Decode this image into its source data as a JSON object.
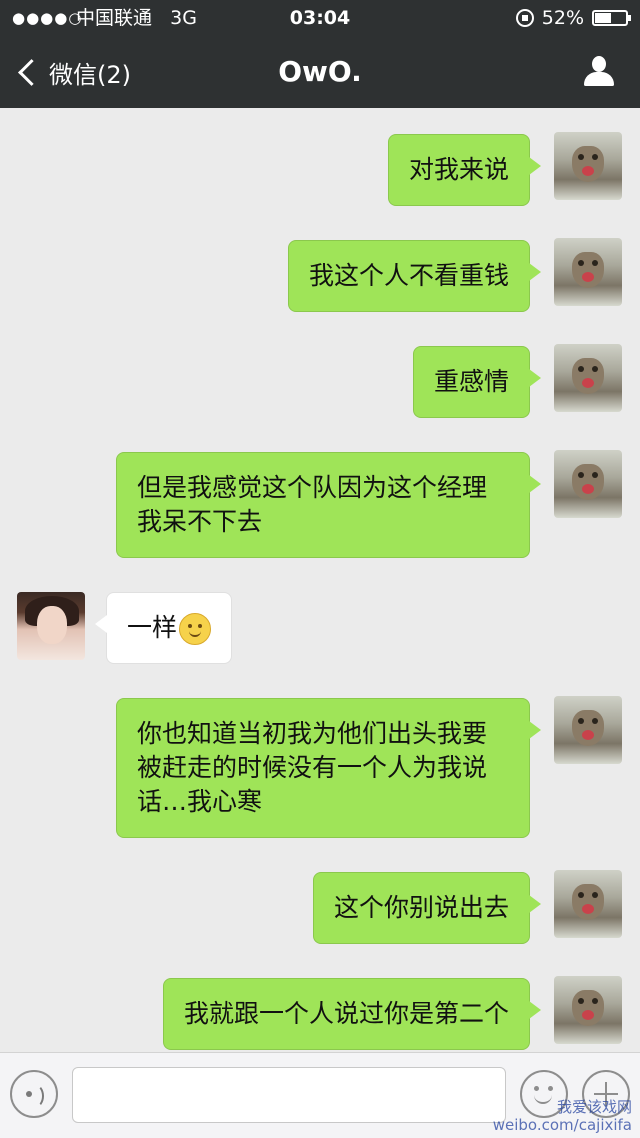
{
  "status_bar": {
    "signal": "●●●●○",
    "carrier": "中国联通",
    "network": "3G",
    "time": "03:04",
    "battery": "52%",
    "battery_level": 0.52
  },
  "nav": {
    "back_label": "微信(2)",
    "title": "OwO."
  },
  "messages": [
    {
      "sender": "me",
      "text": "对我来说"
    },
    {
      "sender": "me",
      "text": "我这个人不看重钱"
    },
    {
      "sender": "me",
      "text": "重感情"
    },
    {
      "sender": "me",
      "text": "但是我感觉这个队因为这个经理我呆不下去"
    },
    {
      "sender": "them",
      "text": "一样",
      "emoji": "smile-icon"
    },
    {
      "sender": "me",
      "text": "你也知道当初我为他们出头我要被赶走的时候没有一个人为我说话…我心寒"
    },
    {
      "sender": "me",
      "text": "这个你别说出去"
    },
    {
      "sender": "me",
      "text": "我就跟一个人说过你是第二个"
    }
  ],
  "input_bar": {
    "placeholder": ""
  },
  "watermark": {
    "line1": "我爱该戏网",
    "line2": "weibo.com/cajixifa"
  }
}
